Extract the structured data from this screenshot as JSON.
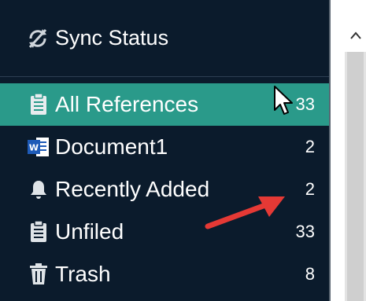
{
  "sync": {
    "label": "Sync Status",
    "icon": "sync-off-icon"
  },
  "items": [
    {
      "label": "All References",
      "count": "33",
      "icon": "clipboard-icon",
      "active": true
    },
    {
      "label": "Document1",
      "count": "2",
      "icon": "word-document-icon",
      "active": false
    },
    {
      "label": "Recently Added",
      "count": "2",
      "icon": "bell-icon",
      "active": false
    },
    {
      "label": "Unfiled",
      "count": "33",
      "icon": "clipboard-icon",
      "active": false
    },
    {
      "label": "Trash",
      "count": "8",
      "icon": "trash-icon",
      "active": false
    }
  ],
  "colors": {
    "sidebar_bg": "#0b1b2c",
    "active_bg": "#2a9a8a",
    "text": "#ffffff",
    "annotation_arrow": "#e53935"
  }
}
